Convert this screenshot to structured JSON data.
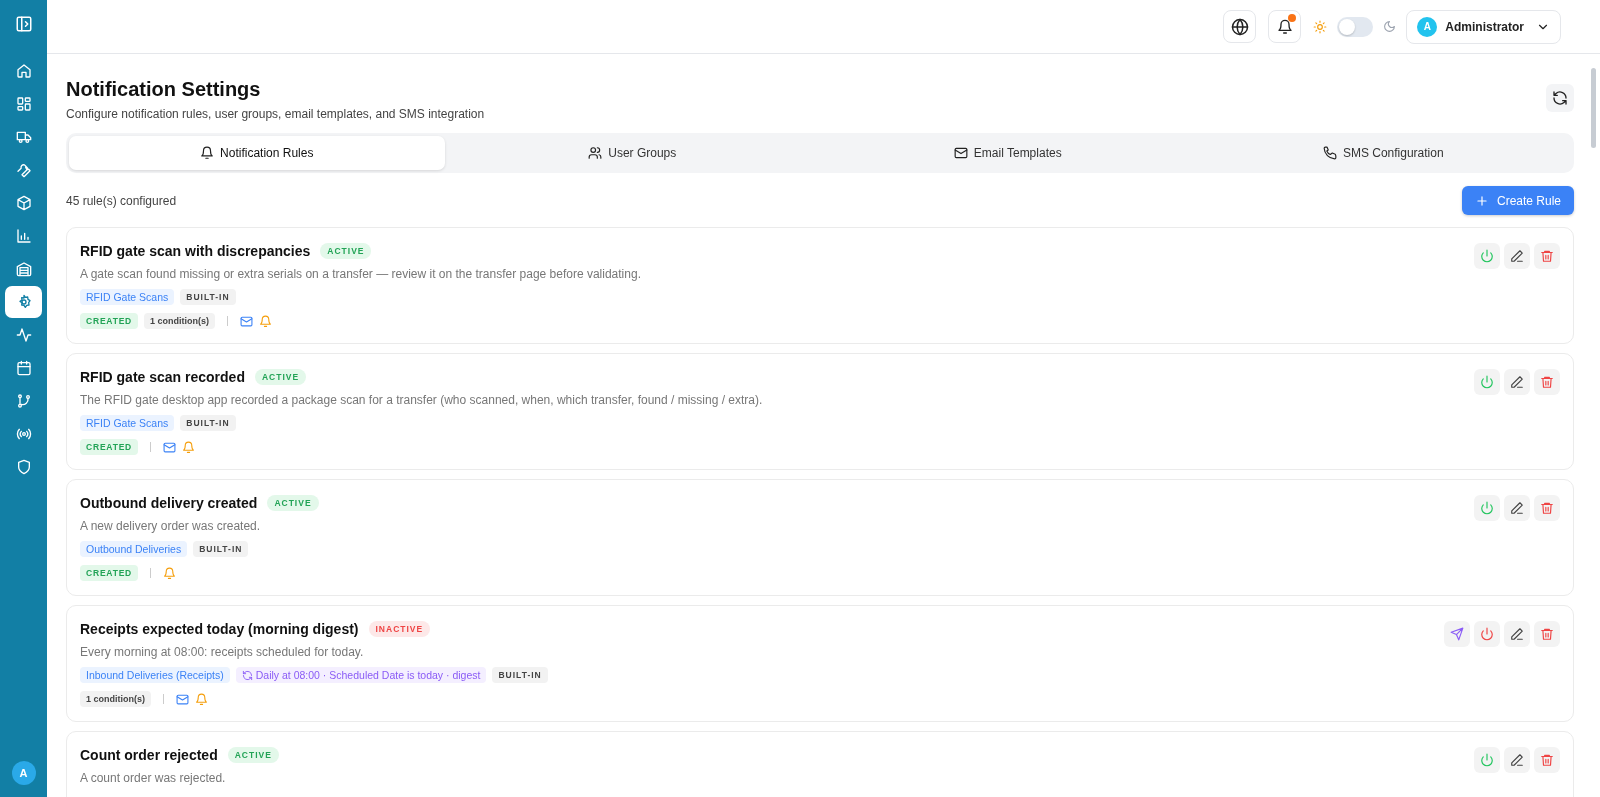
{
  "sidebar": {
    "items": [
      {
        "kind": "home",
        "selected": false
      },
      {
        "kind": "grid",
        "selected": false
      },
      {
        "kind": "truck",
        "selected": false
      },
      {
        "kind": "wrench",
        "selected": false
      },
      {
        "kind": "box",
        "selected": false
      },
      {
        "kind": "chart",
        "selected": false
      },
      {
        "kind": "warehouse",
        "selected": false
      },
      {
        "kind": "settings",
        "selected": true
      },
      {
        "kind": "activity",
        "selected": false
      },
      {
        "kind": "calendar",
        "selected": false
      },
      {
        "kind": "branch",
        "selected": false
      },
      {
        "kind": "radio",
        "selected": false
      },
      {
        "kind": "shield",
        "selected": false
      }
    ],
    "avatar": "A"
  },
  "topbar": {
    "notifications_unread": true,
    "dark_mode": false,
    "user": {
      "initial": "A",
      "name": "Administrator"
    }
  },
  "page": {
    "title": "Notification Settings",
    "subtitle": "Configure notification rules, user groups, email templates, and SMS integration"
  },
  "tabs": [
    {
      "label": "Notification Rules",
      "selected": true
    },
    {
      "label": "User Groups",
      "selected": false
    },
    {
      "label": "Email Templates",
      "selected": false
    },
    {
      "label": "SMS Configuration",
      "selected": false
    }
  ],
  "rules_count": "45 rule(s) configured",
  "create_button": "Create Rule",
  "rules": [
    {
      "title": "RFID gate scan with discrepancies",
      "status": "ACTIVE",
      "active": true,
      "description": "A gate scan found missing or extra serials on a transfer — review it on the transfer page before validating.",
      "tags": [
        {
          "kind": "category",
          "text": "RFID Gate Scans"
        },
        {
          "kind": "builtin",
          "text": "BUILT-IN"
        }
      ],
      "trigger": "CREATED",
      "conditions": "1 condition(s)",
      "email": true,
      "in_app": true,
      "test_send": false
    },
    {
      "title": "RFID gate scan recorded",
      "status": "ACTIVE",
      "active": true,
      "description": "The RFID gate desktop app recorded a package scan for a transfer (who scanned, when, which transfer, found / missing / extra).",
      "tags": [
        {
          "kind": "category",
          "text": "RFID Gate Scans"
        },
        {
          "kind": "builtin",
          "text": "BUILT-IN"
        }
      ],
      "trigger": "CREATED",
      "email": true,
      "in_app": true,
      "test_send": false
    },
    {
      "title": "Outbound delivery created",
      "status": "ACTIVE",
      "active": true,
      "description": "A new delivery order was created.",
      "tags": [
        {
          "kind": "category",
          "text": "Outbound Deliveries"
        },
        {
          "kind": "builtin",
          "text": "BUILT-IN"
        }
      ],
      "trigger": "CREATED",
      "email": false,
      "in_app": true,
      "test_send": false
    },
    {
      "title": "Receipts expected today (morning digest)",
      "status": "INACTIVE",
      "active": false,
      "description": "Every morning at 08:00: receipts scheduled for today.",
      "tags": [
        {
          "kind": "category",
          "text": "Inbound Deliveries (Receipts)"
        },
        {
          "kind": "schedule",
          "text": "Daily at 08:00 · Scheduled Date is today · digest"
        },
        {
          "kind": "builtin",
          "text": "BUILT-IN"
        }
      ],
      "conditions": "1 condition(s)",
      "email": true,
      "in_app": true,
      "test_send": true
    },
    {
      "title": "Count order rejected",
      "status": "ACTIVE",
      "active": true,
      "description": "A count order was rejected."
    }
  ]
}
